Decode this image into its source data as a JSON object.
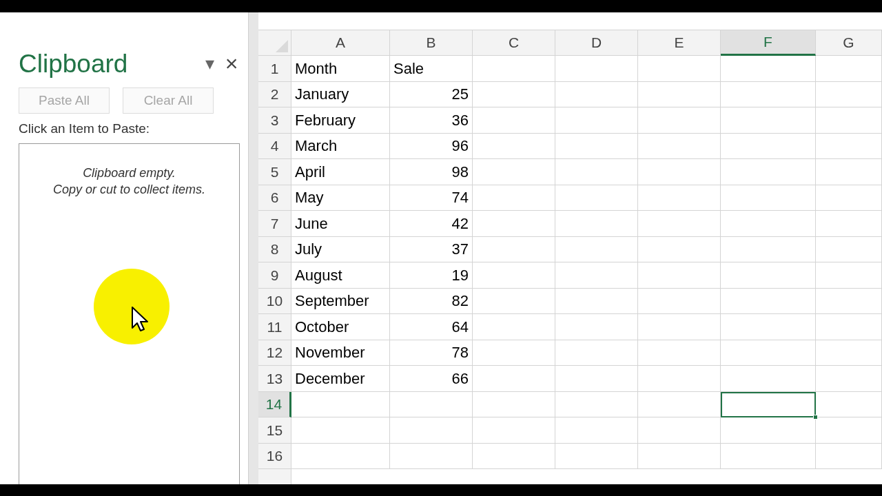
{
  "clipboard_pane": {
    "title": "Clipboard",
    "menu_arrow": "▾",
    "close": "×",
    "buttons": [
      {
        "label": "Paste All",
        "disabled": true
      },
      {
        "label": "Clear All",
        "disabled": true
      }
    ],
    "instruction": "Click an Item to Paste:",
    "empty_message": [
      "Clipboard empty.",
      "Copy or cut to collect items."
    ]
  },
  "sheet": {
    "columns": [
      {
        "label": "A",
        "selected": false
      },
      {
        "label": "B",
        "selected": false
      },
      {
        "label": "C",
        "selected": false
      },
      {
        "label": "D",
        "selected": false
      },
      {
        "label": "E",
        "selected": false
      },
      {
        "label": "F",
        "selected": true
      },
      {
        "label": "G",
        "selected": false
      }
    ],
    "rows": [
      {
        "number": "1",
        "selected": false,
        "cells": [
          {
            "text": "Month",
            "kind": "text"
          },
          {
            "text": "Sale",
            "kind": "text"
          }
        ]
      },
      {
        "number": "2",
        "selected": false,
        "cells": [
          {
            "text": "January",
            "kind": "text"
          },
          {
            "text": "25",
            "kind": "number"
          }
        ]
      },
      {
        "number": "3",
        "selected": false,
        "cells": [
          {
            "text": "February",
            "kind": "text"
          },
          {
            "text": "36",
            "kind": "number"
          }
        ]
      },
      {
        "number": "4",
        "selected": false,
        "cells": [
          {
            "text": "March",
            "kind": "text"
          },
          {
            "text": "96",
            "kind": "number"
          }
        ]
      },
      {
        "number": "5",
        "selected": false,
        "cells": [
          {
            "text": "April",
            "kind": "text"
          },
          {
            "text": "98",
            "kind": "number"
          }
        ]
      },
      {
        "number": "6",
        "selected": false,
        "cells": [
          {
            "text": "May",
            "kind": "text"
          },
          {
            "text": "74",
            "kind": "number"
          }
        ]
      },
      {
        "number": "7",
        "selected": false,
        "cells": [
          {
            "text": "June",
            "kind": "text"
          },
          {
            "text": "42",
            "kind": "number"
          }
        ]
      },
      {
        "number": "8",
        "selected": false,
        "cells": [
          {
            "text": "July",
            "kind": "text"
          },
          {
            "text": "37",
            "kind": "number"
          }
        ]
      },
      {
        "number": "9",
        "selected": false,
        "cells": [
          {
            "text": "August",
            "kind": "text"
          },
          {
            "text": "19",
            "kind": "number"
          }
        ]
      },
      {
        "number": "10",
        "selected": false,
        "cells": [
          {
            "text": "September",
            "kind": "text"
          },
          {
            "text": "82",
            "kind": "number"
          }
        ]
      },
      {
        "number": "11",
        "selected": false,
        "cells": [
          {
            "text": "October",
            "kind": "text"
          },
          {
            "text": "64",
            "kind": "number"
          }
        ]
      },
      {
        "number": "12",
        "selected": false,
        "cells": [
          {
            "text": "November",
            "kind": "text"
          },
          {
            "text": "78",
            "kind": "number"
          }
        ]
      },
      {
        "number": "13",
        "selected": false,
        "cells": [
          {
            "text": "December",
            "kind": "text"
          },
          {
            "text": "66",
            "kind": "number"
          }
        ]
      },
      {
        "number": "14",
        "selected": true,
        "cells": []
      },
      {
        "number": "15",
        "selected": false,
        "cells": []
      },
      {
        "number": "16",
        "selected": false,
        "cells": []
      }
    ]
  }
}
